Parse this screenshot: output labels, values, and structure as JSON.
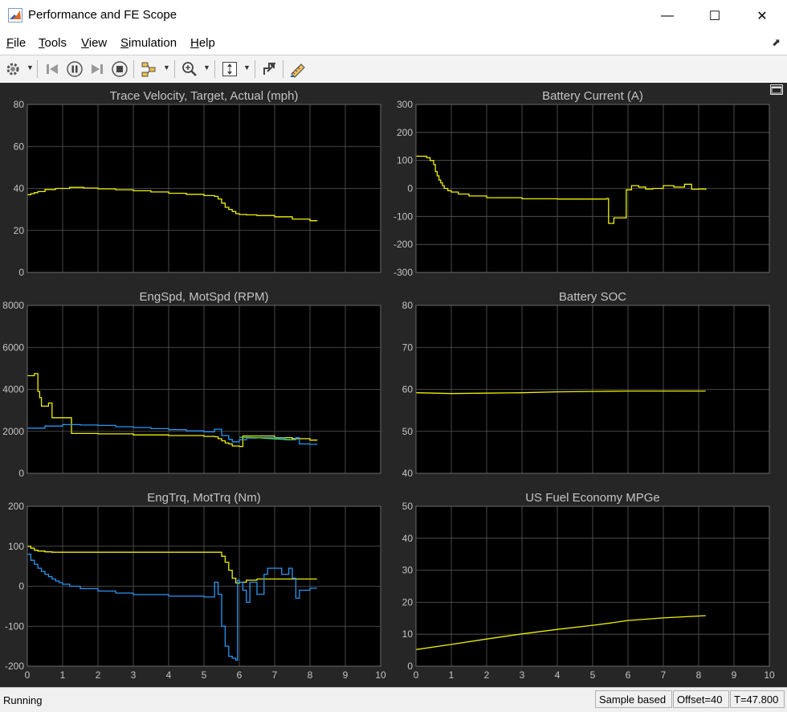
{
  "window": {
    "title": "Performance and FE Scope",
    "minimize": "—",
    "maximize": "☐",
    "close": "✕"
  },
  "menu": {
    "items": [
      {
        "label": "File",
        "u": "F",
        "rest": "ile"
      },
      {
        "label": "Tools",
        "u": "T",
        "rest": "ools"
      },
      {
        "label": "View",
        "u": "V",
        "rest": "iew"
      },
      {
        "label": "Simulation",
        "u": "S",
        "rest": "imulation"
      },
      {
        "label": "Help",
        "u": "H",
        "rest": "elp"
      }
    ]
  },
  "toolbar": {
    "icons": [
      "gear-icon",
      "step-back-icon",
      "pause-icon",
      "step-forward-icon",
      "stop-icon",
      "highlight-blocks-icon",
      "zoom-icon",
      "autoscale-icon",
      "undock-axes-icon",
      "measurement-icon"
    ]
  },
  "colors": {
    "yellow": "#f0f000",
    "blue": "#2a96f0",
    "green": "#4fcf4f",
    "axes_bg": "#000000",
    "figure_bg": "#262626",
    "grid": "#5a5a5a",
    "text": "#c4c4c4"
  },
  "chart_data": [
    {
      "type": "line",
      "title": "Trace Velocity, Target, Actual (mph)",
      "xlim": [
        0,
        10
      ],
      "ylim": [
        0,
        80
      ],
      "yticks": [
        0,
        20,
        40,
        60,
        80
      ],
      "xticks": [],
      "grid": true,
      "series": [
        {
          "color": "yellow",
          "step": true,
          "x": [
            0,
            0.1,
            0.2,
            0.3,
            0.5,
            0.8,
            1.2,
            1.6,
            2.0,
            2.5,
            3.0,
            3.5,
            4.0,
            4.5,
            5.0,
            5.3,
            5.4,
            5.5,
            5.6,
            5.7,
            5.8,
            5.9,
            6.0,
            6.2,
            6.5,
            7.0,
            7.5,
            8.0,
            8.2
          ],
          "y": [
            37,
            37.5,
            38,
            38.5,
            39.5,
            40,
            40.5,
            40.2,
            39.8,
            39.4,
            38.9,
            38.3,
            37.7,
            37.2,
            36.6,
            36.2,
            35,
            33,
            31,
            30,
            29,
            28,
            27.6,
            27.4,
            27.1,
            26.5,
            25.4,
            24.6,
            24.5
          ]
        }
      ]
    },
    {
      "type": "line",
      "title": "Battery Current (A)",
      "xlim": [
        0,
        10
      ],
      "ylim": [
        -300,
        300
      ],
      "yticks": [
        -300,
        -200,
        -100,
        0,
        100,
        200,
        300
      ],
      "xticks": [],
      "grid": true,
      "series": [
        {
          "color": "yellow",
          "step": true,
          "x": [
            0,
            0.3,
            0.4,
            0.5,
            0.55,
            0.6,
            0.65,
            0.7,
            0.75,
            0.8,
            0.9,
            1.0,
            1.2,
            1.5,
            2.0,
            3.0,
            4.0,
            5.0,
            5.4,
            5.45,
            5.6,
            5.9,
            5.95,
            6.1,
            6.3,
            6.5,
            6.7,
            7.0,
            7.3,
            7.6,
            7.8,
            8.0,
            8.2
          ],
          "y": [
            115,
            110,
            100,
            85,
            60,
            45,
            30,
            20,
            10,
            0,
            -8,
            -13,
            -20,
            -27,
            -33,
            -37,
            -38,
            -38,
            -36,
            -125,
            -105,
            -105,
            -5,
            10,
            5,
            -2,
            0,
            10,
            5,
            15,
            -3,
            -2,
            -5
          ]
        }
      ]
    },
    {
      "type": "line",
      "title": "EngSpd, MotSpd (RPM)",
      "xlim": [
        0,
        10
      ],
      "ylim": [
        0,
        8000
      ],
      "yticks": [
        0,
        2000,
        4000,
        6000,
        8000
      ],
      "xticks": [],
      "grid": true,
      "series": [
        {
          "color": "yellow",
          "step": true,
          "x": [
            0,
            0.2,
            0.3,
            0.35,
            0.4,
            0.6,
            0.7,
            1.2,
            1.25,
            2.0,
            3.0,
            4.0,
            5.0,
            5.3,
            5.4,
            5.5,
            5.6,
            5.7,
            5.8,
            6.0,
            6.1,
            6.4,
            7.0,
            7.5,
            8.0,
            8.2
          ],
          "y": [
            4650,
            4750,
            3900,
            3600,
            3200,
            3350,
            2650,
            2650,
            1900,
            1880,
            1830,
            1800,
            1760,
            1740,
            1650,
            1550,
            1450,
            1400,
            1300,
            1280,
            1780,
            1780,
            1700,
            1650,
            1580,
            1570
          ]
        },
        {
          "color": "blue",
          "step": true,
          "x": [
            0,
            0.5,
            1.0,
            1.5,
            2.0,
            2.5,
            3.0,
            3.5,
            4.0,
            4.5,
            5.0,
            5.3,
            5.5,
            5.7,
            5.8,
            6.0,
            6.2,
            6.5,
            7.0,
            7.3,
            7.6,
            7.7,
            8.0,
            8.2
          ],
          "y": [
            2150,
            2250,
            2320,
            2300,
            2280,
            2220,
            2180,
            2130,
            2080,
            2020,
            1980,
            2100,
            1800,
            1620,
            1500,
            1600,
            1680,
            1700,
            1680,
            1600,
            1700,
            1400,
            1380,
            1360
          ]
        },
        {
          "color": "green",
          "step": false,
          "x": [
            6.0,
            6.5,
            7.0,
            7.5
          ],
          "y": [
            1720,
            1700,
            1640,
            1600
          ]
        }
      ]
    },
    {
      "type": "line",
      "title": "Battery SOC",
      "xlim": [
        0,
        10
      ],
      "ylim": [
        40,
        80
      ],
      "yticks": [
        40,
        50,
        60,
        70,
        80
      ],
      "xticks": [],
      "grid": true,
      "series": [
        {
          "color": "yellow",
          "step": false,
          "x": [
            0,
            1,
            2,
            3,
            4,
            5,
            6,
            7,
            8.2
          ],
          "y": [
            59.2,
            59.0,
            59.1,
            59.2,
            59.4,
            59.5,
            59.6,
            59.6,
            59.6
          ]
        }
      ]
    },
    {
      "type": "line",
      "title": "EngTrq, MotTrq (Nm)",
      "xlim": [
        0,
        10
      ],
      "ylim": [
        -200,
        200
      ],
      "yticks": [
        -200,
        -100,
        0,
        100,
        200
      ],
      "xticks": [
        0,
        1,
        2,
        3,
        4,
        5,
        6,
        7,
        8,
        9,
        10
      ],
      "grid": true,
      "series": [
        {
          "color": "yellow",
          "step": true,
          "x": [
            0,
            0.1,
            0.2,
            0.3,
            0.5,
            0.7,
            1.0,
            2.0,
            3.0,
            4.0,
            5.0,
            5.4,
            5.5,
            5.6,
            5.7,
            5.8,
            5.9,
            6.0,
            6.2,
            6.5,
            7.0,
            7.5,
            8.0,
            8.2
          ],
          "y": [
            100,
            95,
            90,
            88,
            86,
            85,
            85,
            85,
            85,
            85,
            85,
            85,
            75,
            60,
            40,
            20,
            8,
            10,
            15,
            18,
            18,
            18,
            18,
            18
          ]
        },
        {
          "color": "blue",
          "step": true,
          "x": [
            0,
            0.1,
            0.2,
            0.3,
            0.4,
            0.5,
            0.6,
            0.7,
            0.8,
            0.9,
            1.0,
            1.2,
            1.5,
            2.0,
            2.5,
            3.0,
            4.0,
            5.0,
            5.2,
            5.3,
            5.4,
            5.5,
            5.6,
            5.7,
            5.8,
            5.9,
            5.95,
            6.0,
            6.1,
            6.2,
            6.3,
            6.5,
            6.7,
            6.8,
            7.0,
            7.2,
            7.4,
            7.5,
            7.6,
            7.7,
            8.0,
            8.2
          ],
          "y": [
            80,
            65,
            55,
            45,
            37,
            30,
            24,
            18,
            13,
            9,
            5,
            0,
            -6,
            -12,
            -17,
            -21,
            -25,
            -27,
            -27,
            10,
            -20,
            -100,
            -150,
            -175,
            -180,
            -185,
            15,
            10,
            -10,
            -40,
            10,
            -20,
            30,
            45,
            45,
            30,
            45,
            20,
            -30,
            -10,
            -5,
            -5
          ]
        }
      ]
    },
    {
      "type": "line",
      "title": "US Fuel Economy MPGe",
      "xlim": [
        0,
        10
      ],
      "ylim": [
        0,
        50
      ],
      "yticks": [
        0,
        10,
        20,
        30,
        40,
        50
      ],
      "xticks": [
        0,
        1,
        2,
        3,
        4,
        5,
        6,
        7,
        8,
        9,
        10
      ],
      "grid": true,
      "series": [
        {
          "color": "yellow",
          "step": false,
          "x": [
            0,
            1,
            2,
            3,
            4,
            5,
            5.5,
            6,
            7,
            8.2
          ],
          "y": [
            5.2,
            6.8,
            8.5,
            10.1,
            11.5,
            12.8,
            13.5,
            14.3,
            15.1,
            15.8
          ]
        }
      ]
    }
  ],
  "status": {
    "state": "Running",
    "mode": "Sample based",
    "offset": "Offset=40",
    "time": "T=47.800"
  }
}
